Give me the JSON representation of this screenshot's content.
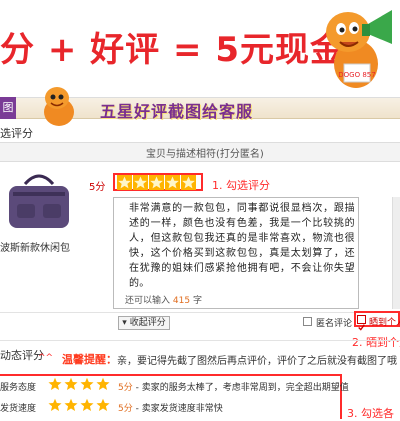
{
  "banner": {
    "text": "分 + 好评 = 5元现金",
    "mascot_badge": "DOGO 857"
  },
  "band": {
    "left_label": "图",
    "title": "五星好评截图给客服"
  },
  "rating_section": {
    "heading": "选评分",
    "column_header": "宝贝与描述相符(打分匿名)"
  },
  "product": {
    "name": "波斯新款休闲包",
    "score_label": "5分",
    "rating": 5
  },
  "annotations": {
    "step1": "1. 勾选评分",
    "step2": "2. 晒到个人",
    "step3": "3. 勾选各"
  },
  "review": {
    "text": "非常满意的一款包包，同事都说很显档次，跟描述的一样，颜色也没有色差，我是一个比较挑的人，但这款包包我还真的是非常喜欢，物流也很快，这个价格买到这款包包，真是太划算了，还在犹豫的姐妹们感紧抢他拥有吧，不会让你失望的。",
    "count_prefix": "还可以输入",
    "count_value": "415",
    "count_suffix": "字"
  },
  "controls": {
    "collapse_button": "收起评分",
    "anonymous_label": "匿名评论",
    "share_label": "晒到个人"
  },
  "dynamic_rating": {
    "heading": "动态评分",
    "smile": "^^",
    "tip_title": "温馨提醒：",
    "tip_body": "亲，要记得先截了图然后再点评价，评价了之后就没有截图了哦",
    "rows": [
      {
        "label": "服务态度",
        "score": "5分",
        "desc": " - 卖家的服务太棒了，考虑非常周到，完全超出期望值",
        "rating": 5
      },
      {
        "label": "发货速度",
        "score": "5分",
        "desc": " - 卖家发货速度非常快",
        "rating": 5
      }
    ]
  },
  "colors": {
    "accent": "#ff2b2b",
    "purple": "#7a3b96",
    "star": "#ffb400"
  }
}
